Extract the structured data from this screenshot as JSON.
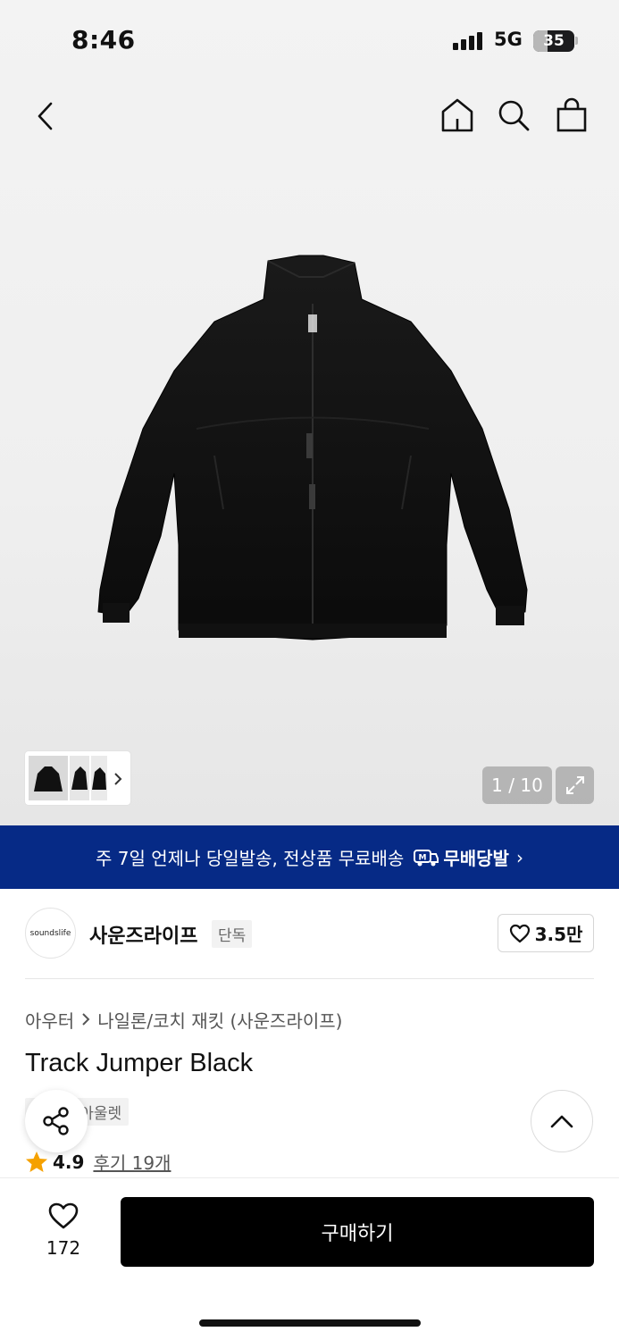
{
  "status_bar": {
    "time": "8:46",
    "network": "5G",
    "battery": "35",
    "battery_fraction": 0.35
  },
  "top_nav": {
    "icons": [
      "back-icon",
      "home-icon",
      "search-icon",
      "shopping-bag-icon"
    ]
  },
  "gallery": {
    "counter": "1 / 10",
    "current": 1,
    "total": 10
  },
  "shipping_banner": {
    "text": "주 7일 언제나 당일발송, 전상품 무료배송",
    "brand": "무배당발"
  },
  "brand": {
    "logo_text": "soundslife",
    "name": "사운즈라이프",
    "tag": "단독",
    "likes": "3.5만"
  },
  "breadcrumb": {
    "category": "아우터",
    "subcategory": "나일론/코치 재킷 (사운즈라이프)"
  },
  "product": {
    "title": "Track Jumper Black",
    "tags": [
      "단독",
      "아울렛"
    ],
    "rating": "4.9",
    "reviews": "후기 19개"
  },
  "bottom_bar": {
    "wish_count": "172",
    "buy_label": "구매하기"
  },
  "colors": {
    "banner": "#062a86",
    "star": "#f5a100",
    "buy_button": "#000000"
  }
}
